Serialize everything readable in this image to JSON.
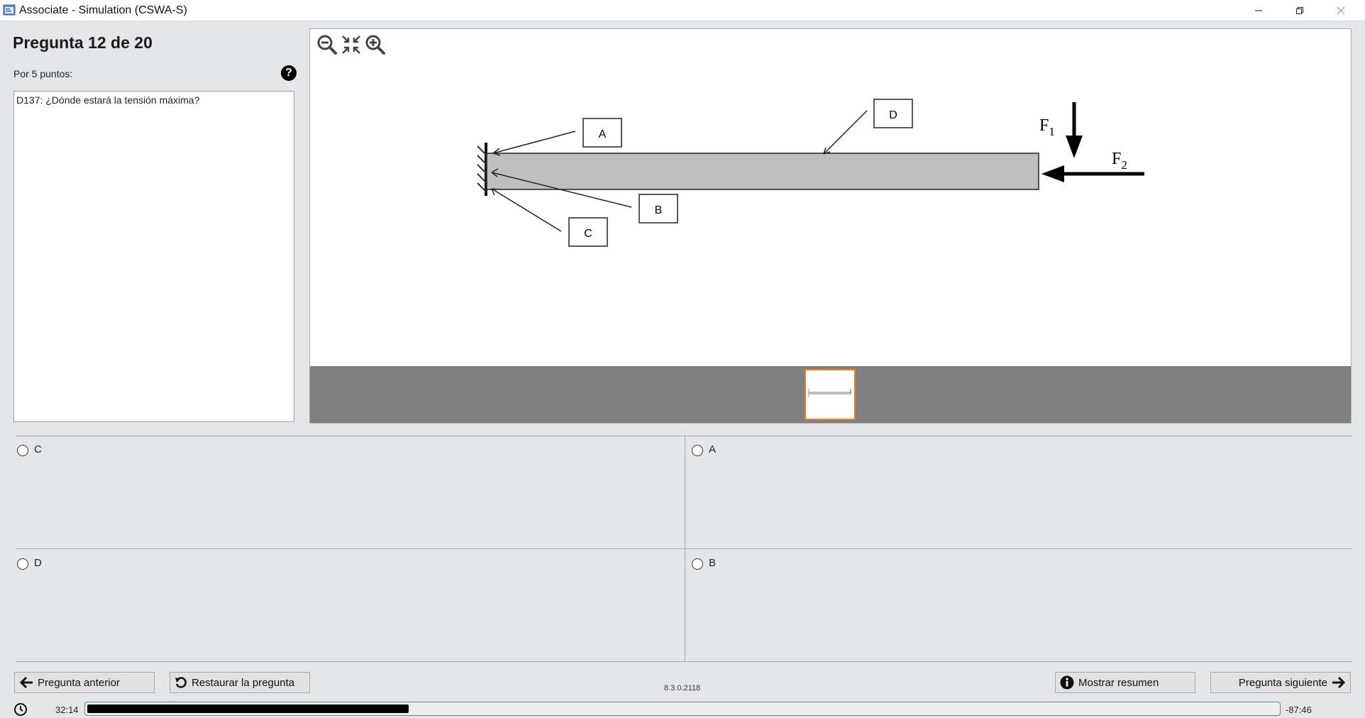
{
  "window": {
    "title": "Associate - Simulation (CSWA-S)"
  },
  "question": {
    "heading": "Pregunta 12 de 20",
    "points": "Por 5 puntos:",
    "help": "?",
    "text": "D137: ¿Dónde estará la tensión máxima?"
  },
  "diagram": {
    "labels": {
      "A": "A",
      "B": "B",
      "C": "C",
      "D": "D"
    },
    "force1": "F",
    "force1_sub": "1",
    "force2": "F",
    "force2_sub": "2",
    "colors": {
      "beam": "#bfbfbf",
      "strip": "#808080",
      "thumb_border": "#f07c1c"
    }
  },
  "answers": {
    "opt1": "C",
    "opt2": "A",
    "opt3": "D",
    "opt4": "B"
  },
  "buttons": {
    "prev": "Pregunta anterior",
    "restore": "Restaurar la pregunta",
    "summary": "Mostrar resumen",
    "next": "Pregunta siguiente"
  },
  "version": "8.3.0.2118",
  "timer": {
    "elapsed": "32:14",
    "remaining": "-87:46",
    "progress_fraction": 0.27
  }
}
